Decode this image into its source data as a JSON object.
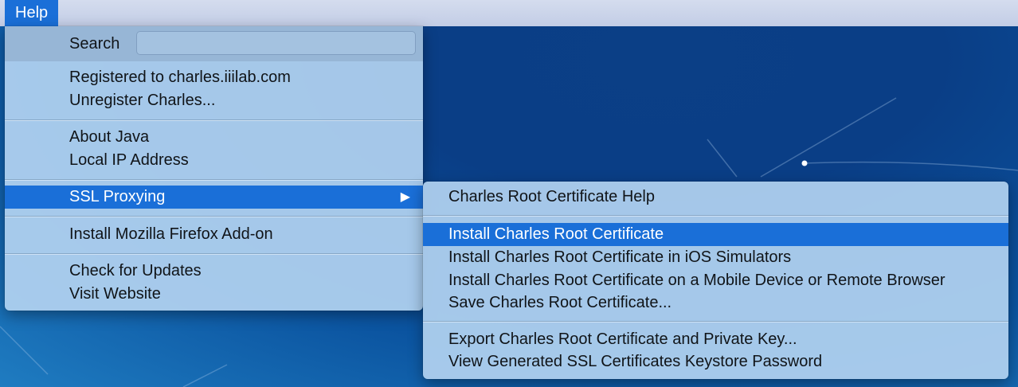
{
  "menubar": {
    "help_label": "Help"
  },
  "help_menu": {
    "search_label": "Search",
    "search_value": "",
    "groups": [
      [
        "Registered to charles.iiilab.com",
        "Unregister Charles..."
      ],
      [
        "About Java",
        "Local IP Address"
      ],
      [
        "SSL Proxying"
      ],
      [
        "Install Mozilla Firefox Add-on"
      ],
      [
        "Check for Updates",
        "Visit Website"
      ]
    ],
    "submenu_arrow": "▶"
  },
  "ssl_submenu": {
    "groups": [
      [
        "Charles Root Certificate Help"
      ],
      [
        "Install Charles Root Certificate",
        "Install Charles Root Certificate in iOS Simulators",
        "Install Charles Root Certificate on a Mobile Device or Remote Browser",
        "Save Charles Root Certificate..."
      ],
      [
        "Export Charles Root Certificate and Private Key...",
        "View Generated SSL Certificates Keystore Password"
      ]
    ]
  },
  "colors": {
    "highlight": "#1a6fd8",
    "menubar": "#c8d2ea",
    "menu": "#b2d2f0"
  }
}
